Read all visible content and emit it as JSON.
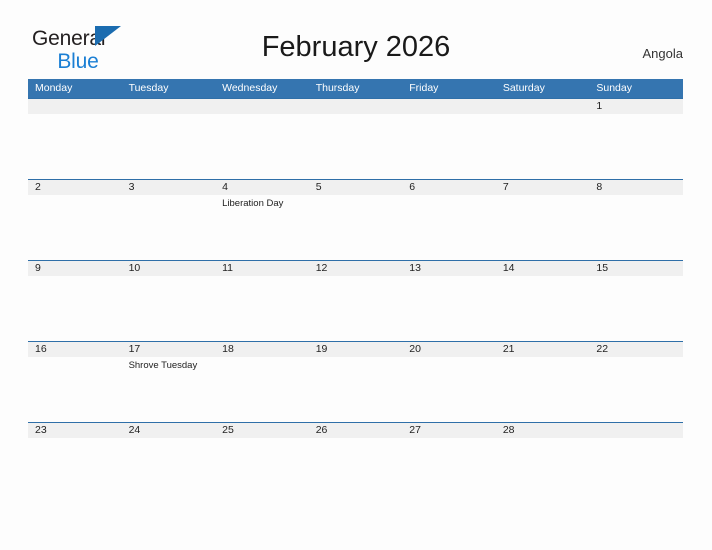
{
  "brand": {
    "name_part1": "General",
    "name_part2": "Blue",
    "flag_icon": "blue-triangle-flag-icon",
    "accent_color": "#1b7fd4"
  },
  "header": {
    "title": "February 2026",
    "country": "Angola"
  },
  "theme": {
    "header_bar_color": "#3575b0",
    "date_bar_color": "#f0f0f0",
    "row_rule_color": "#2f6fa8",
    "page_background": "#fdfdfd"
  },
  "calendar": {
    "month": "February",
    "year": "2026",
    "weekday_headers": [
      "Monday",
      "Tuesday",
      "Wednesday",
      "Thursday",
      "Friday",
      "Saturday",
      "Sunday"
    ],
    "weeks": [
      {
        "days": [
          {
            "date": "",
            "events": []
          },
          {
            "date": "",
            "events": []
          },
          {
            "date": "",
            "events": []
          },
          {
            "date": "",
            "events": []
          },
          {
            "date": "",
            "events": []
          },
          {
            "date": "",
            "events": []
          },
          {
            "date": "1",
            "events": []
          }
        ]
      },
      {
        "days": [
          {
            "date": "2",
            "events": []
          },
          {
            "date": "3",
            "events": []
          },
          {
            "date": "4",
            "events": [
              "Liberation Day"
            ]
          },
          {
            "date": "5",
            "events": []
          },
          {
            "date": "6",
            "events": []
          },
          {
            "date": "7",
            "events": []
          },
          {
            "date": "8",
            "events": []
          }
        ]
      },
      {
        "days": [
          {
            "date": "9",
            "events": []
          },
          {
            "date": "10",
            "events": []
          },
          {
            "date": "11",
            "events": []
          },
          {
            "date": "12",
            "events": []
          },
          {
            "date": "13",
            "events": []
          },
          {
            "date": "14",
            "events": []
          },
          {
            "date": "15",
            "events": []
          }
        ]
      },
      {
        "days": [
          {
            "date": "16",
            "events": []
          },
          {
            "date": "17",
            "events": [
              "Shrove Tuesday"
            ]
          },
          {
            "date": "18",
            "events": []
          },
          {
            "date": "19",
            "events": []
          },
          {
            "date": "20",
            "events": []
          },
          {
            "date": "21",
            "events": []
          },
          {
            "date": "22",
            "events": []
          }
        ]
      },
      {
        "days": [
          {
            "date": "23",
            "events": []
          },
          {
            "date": "24",
            "events": []
          },
          {
            "date": "25",
            "events": []
          },
          {
            "date": "26",
            "events": []
          },
          {
            "date": "27",
            "events": []
          },
          {
            "date": "28",
            "events": []
          },
          {
            "date": "",
            "events": []
          }
        ]
      }
    ]
  }
}
